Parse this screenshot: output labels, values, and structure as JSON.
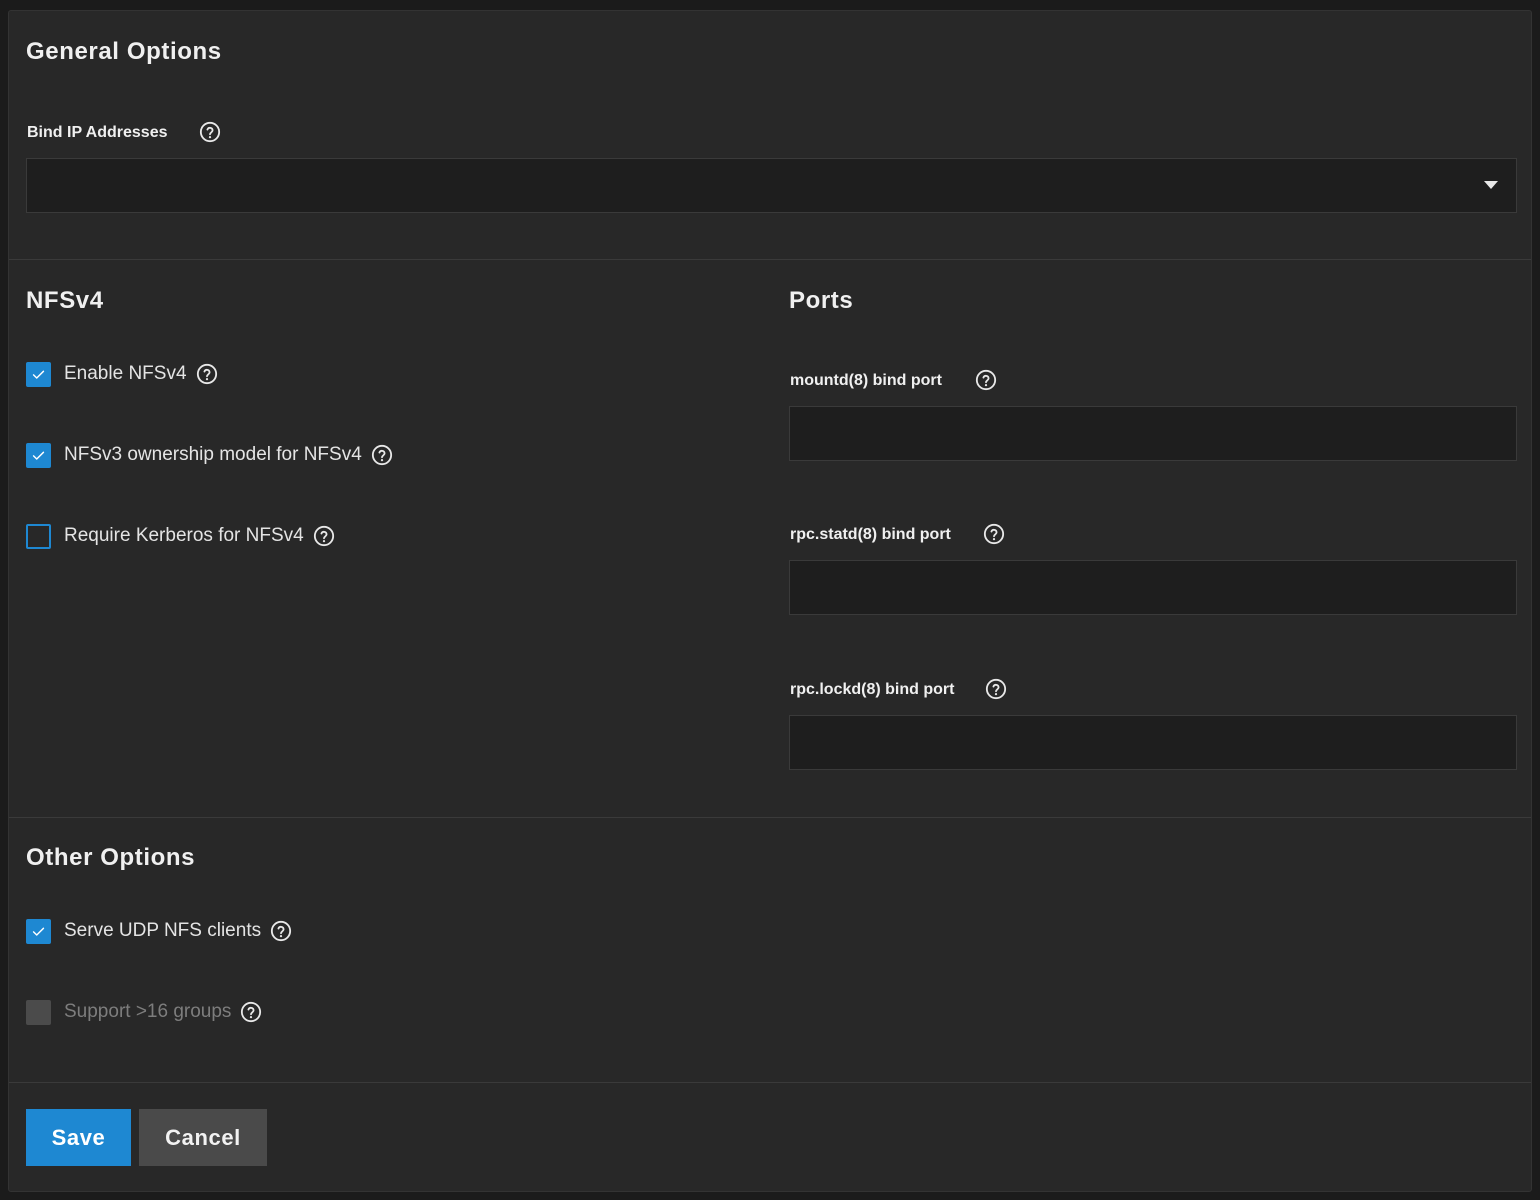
{
  "general": {
    "title": "General Options",
    "bind_ip_label": "Bind IP Addresses",
    "bind_ip_value": ""
  },
  "nfsv4": {
    "title": "NFSv4",
    "options": [
      {
        "label": "Enable NFSv4",
        "checked": true
      },
      {
        "label": "NFSv3 ownership model for NFSv4",
        "checked": true
      },
      {
        "label": "Require Kerberos for NFSv4",
        "checked": false
      }
    ]
  },
  "ports": {
    "title": "Ports",
    "fields": [
      {
        "label": "mountd(8) bind port",
        "value": ""
      },
      {
        "label": "rpc.statd(8) bind port",
        "value": ""
      },
      {
        "label": "rpc.lockd(8) bind port",
        "value": ""
      }
    ]
  },
  "other": {
    "title": "Other Options",
    "options": [
      {
        "label": "Serve UDP NFS clients",
        "checked": true
      },
      {
        "label": "Support >16 groups",
        "checked": false,
        "disabled": true
      }
    ]
  },
  "actions": {
    "save_label": "Save",
    "cancel_label": "Cancel"
  },
  "colors": {
    "accent": "#1e88d2",
    "panel_bg": "#282828",
    "input_bg": "#1e1e1e"
  },
  "icons": {
    "help": "help-circle-icon",
    "checkmark": "checkmark-icon",
    "dropdown": "chevron-down-icon"
  }
}
